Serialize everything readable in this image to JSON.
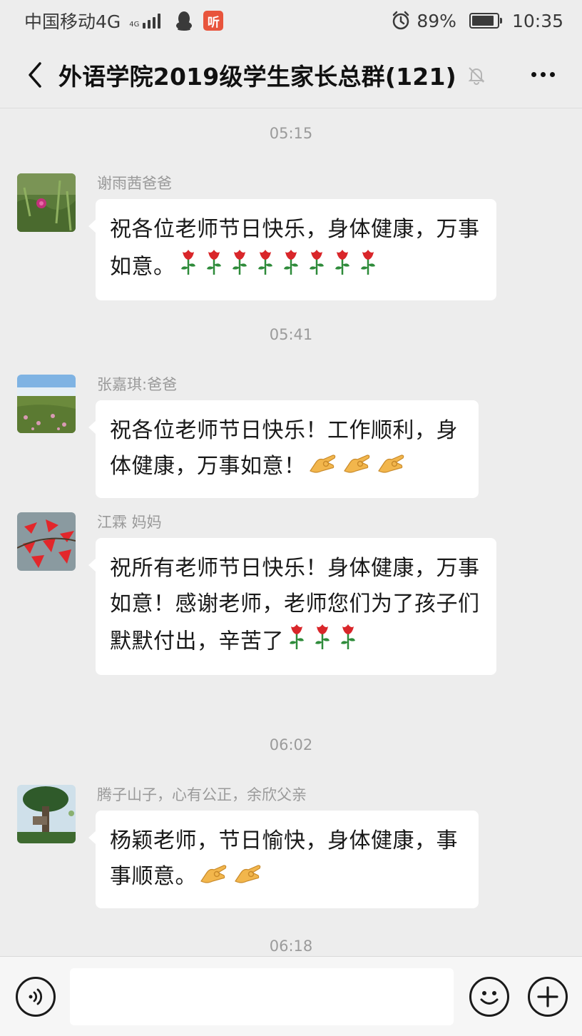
{
  "status_bar": {
    "carrier": "中国移动4G",
    "network_tag": "4G",
    "listen_badge": "听",
    "battery_percent": "89%",
    "battery_level": 0.89,
    "time": "10:35"
  },
  "nav": {
    "title": "外语学院2019级学生家长总群(121)",
    "back_icon": "chevron-left-icon",
    "mute_icon": "bell-off-icon",
    "more_icon": "ellipsis-icon"
  },
  "messages": [
    {
      "time": "05:15",
      "sender": "谢雨茜爸爸",
      "text": "祝各位老师节日快乐，身体健康，万事如意。",
      "emoji": "rose",
      "emoji_count": 8
    },
    {
      "time": "05:41",
      "sender": "张嘉琪:爸爸",
      "text": "祝各位老师节日快乐！工作顺利，身体健康，万事如意！",
      "emoji": "ok-hand",
      "emoji_count": 3
    },
    {
      "time": "",
      "sender": "江霖 妈妈",
      "text": "祝所有老师节日快乐！身体健康，万事如意！感谢老师，老师您们为了孩子们默默付出，辛苦了",
      "emoji": "rose",
      "emoji_count": 3
    },
    {
      "time": "06:02",
      "sender": "腾子山子，心有公正，余欣父亲",
      "text": "杨颖老师，节日愉快，身体健康，事事顺意。",
      "emoji": "ok-hand",
      "emoji_count": 2
    }
  ],
  "last_timestamp": "06:18",
  "input": {
    "value": "",
    "placeholder": ""
  },
  "colors": {
    "background": "#ededed",
    "bubble": "#ffffff",
    "timestamp": "#9b9b9b",
    "sender": "#9a9a9a",
    "rose_red": "#d9262a",
    "leaf_green": "#2e8b3a",
    "hand_yellow": "#f2b64c"
  }
}
